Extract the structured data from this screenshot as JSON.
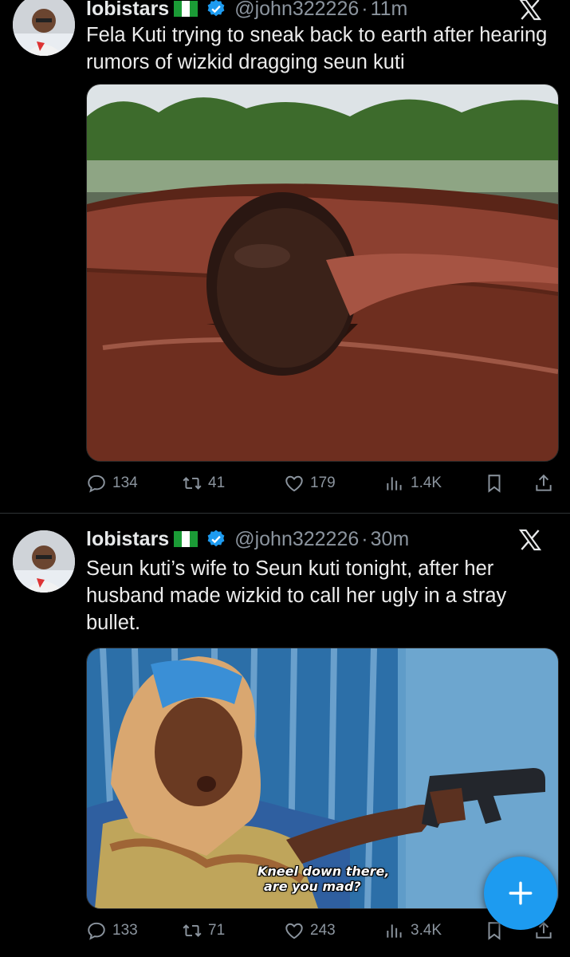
{
  "tweets": [
    {
      "display_name": "lobistars",
      "handle": "@john322226",
      "time": "11m",
      "text": "Fela Kuti trying to sneak back to earth after hearing rumors of wizkid dragging seun kuti",
      "stats": {
        "replies": "134",
        "reposts": "41",
        "likes": "179",
        "views": "1.4K"
      }
    },
    {
      "display_name": "lobistars",
      "handle": "@john322226",
      "time": "30m",
      "text": "Seun kuti’s wife to Seun kuti tonight, after her husband made wizkid to call her ugly in a stray bullet.",
      "image_caption_line1": "Kneel down there,",
      "image_caption_line2": "are you mad?",
      "stats": {
        "replies": "133",
        "reposts": "71",
        "likes": "243",
        "views": "3.4K"
      }
    }
  ],
  "colors": {
    "background": "#000000",
    "secondary_text": "#8b949e",
    "accent": "#1d9bf0",
    "verified": "#1d9bf0"
  },
  "icons": [
    "verified-badge-icon",
    "x-logo-icon",
    "reply-icon",
    "repost-icon",
    "like-icon",
    "views-icon",
    "bookmark-icon",
    "share-icon",
    "compose-plus-icon"
  ]
}
